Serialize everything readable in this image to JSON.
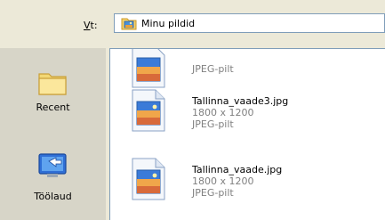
{
  "lookin": {
    "label_prefix": "",
    "label_accel": "V",
    "label_rest": "t:",
    "current_folder": "Minu pildid",
    "current_folder_icon": "my-pictures-folder-icon"
  },
  "places": [
    {
      "label": "Recent",
      "icon": "recent-folder-icon"
    },
    {
      "label": "Töölaud",
      "icon": "desktop-icon"
    }
  ],
  "files": [
    {
      "name": "",
      "dims": "",
      "type": "JPEG-pilt",
      "icon": "jpeg-file-icon"
    },
    {
      "name": "Tallinna_vaade3.jpg",
      "dims": "1800 x 1200",
      "type": "JPEG-pilt",
      "icon": "jpeg-file-icon"
    },
    {
      "name": "Tallinna_vaade.jpg",
      "dims": "1800 x 1200",
      "type": "JPEG-pilt",
      "icon": "jpeg-file-icon"
    }
  ],
  "colors": {
    "dialog_bg": "#ece9d8",
    "places_bg": "#d7d5c8",
    "border": "#7f9db9",
    "meta_text": "#808080"
  }
}
